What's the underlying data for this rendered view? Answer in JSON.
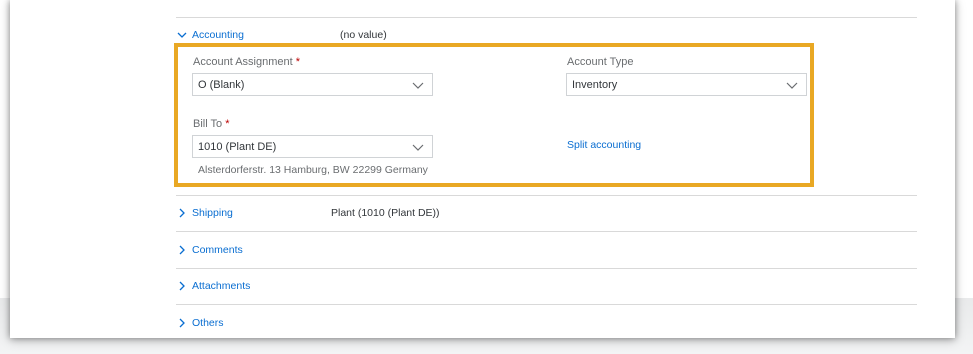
{
  "sections": {
    "accounting": {
      "label": "Accounting",
      "value": "(no value)"
    },
    "shipping": {
      "label": "Shipping",
      "value": "Plant (1010 (Plant DE))"
    },
    "comments": {
      "label": "Comments"
    },
    "attachments": {
      "label": "Attachments"
    },
    "others": {
      "label": "Others"
    }
  },
  "form": {
    "account_assignment": {
      "label": "Account Assignment",
      "required_mark": "*",
      "value": "O (Blank)"
    },
    "account_type": {
      "label": "Account Type",
      "value": "Inventory"
    },
    "bill_to": {
      "label": "Bill To",
      "required_mark": "*",
      "value": "1010 (Plant DE)",
      "address": "Alsterdorferstr. 13 Hamburg, BW 22299 Germany"
    },
    "split_link": "Split accounting"
  },
  "colors": {
    "link": "#0a6ed1",
    "highlight": "#e9a824",
    "required": "#bb0000"
  },
  "icons": {
    "expanded": "chevron-down-icon",
    "collapsed": "chevron-right-icon",
    "dropdown": "chevron-down-icon"
  }
}
